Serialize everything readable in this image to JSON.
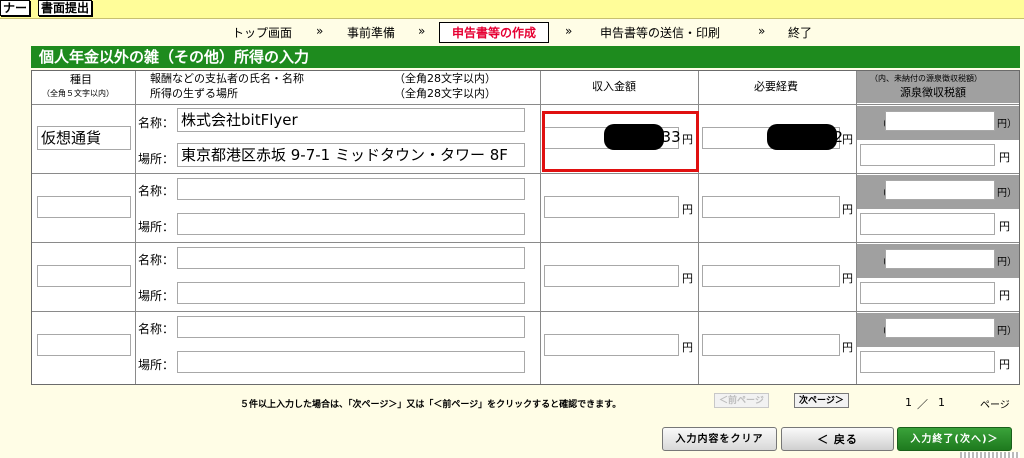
{
  "topbar": {
    "left_btn": "ナー",
    "submit_btn": "書面提出"
  },
  "steps": {
    "items": [
      "トップ画面",
      "事前準備",
      "申告書等の作成",
      "申告書等の送信・印刷",
      "終了"
    ],
    "arrow": "»"
  },
  "section_title": "個人年金以外の雑（その他）所得の入力",
  "headers": {
    "kind": "種目",
    "kind_sub": "（全角５文字以内）",
    "payer_line1": "報酬などの支払者の氏名・名称",
    "payer_limit1": "（全角28文字以内）",
    "payer_line2": "所得の生ずる場所",
    "payer_limit2": "（全角28文字以内）",
    "income": "収入金額",
    "expense": "必要経費",
    "withholding_sub": "（内、未納付の源泉徴収税額）",
    "withholding": "源泉徴収税額"
  },
  "labels": {
    "name": "名称：",
    "place": "場所：",
    "yen": "円",
    "open_paren": "（",
    "close_yen": "円）"
  },
  "rows": [
    {
      "kind": "仮想通貨",
      "name": "株式会社bitFlyer",
      "place": "東京都港区赤坂 9-7-1 ミッドタウン・タワー 8F",
      "income": "433",
      "expense": "42"
    },
    {
      "kind": "",
      "name": "",
      "place": "",
      "income": "",
      "expense": ""
    },
    {
      "kind": "",
      "name": "",
      "place": "",
      "income": "",
      "expense": ""
    },
    {
      "kind": "",
      "name": "",
      "place": "",
      "income": "",
      "expense": ""
    }
  ],
  "footer": {
    "note": "５件以上入力した場合は、「次ページ＞」又は「＜前ページ」をクリックすると確認できます。",
    "prev_page": "＜前ページ",
    "next_page": "次ページ＞",
    "page_current": "1",
    "page_sep": "／",
    "page_total": "1",
    "page_unit": "ページ"
  },
  "actions": {
    "clear": "入力内容をクリア",
    "back": "＜ 戻る",
    "finish": "入力終了(次へ)＞"
  },
  "colors": {
    "section_green": "#1e8b1e",
    "current_step_red": "#e60033",
    "highlight_red": "#e01010"
  }
}
